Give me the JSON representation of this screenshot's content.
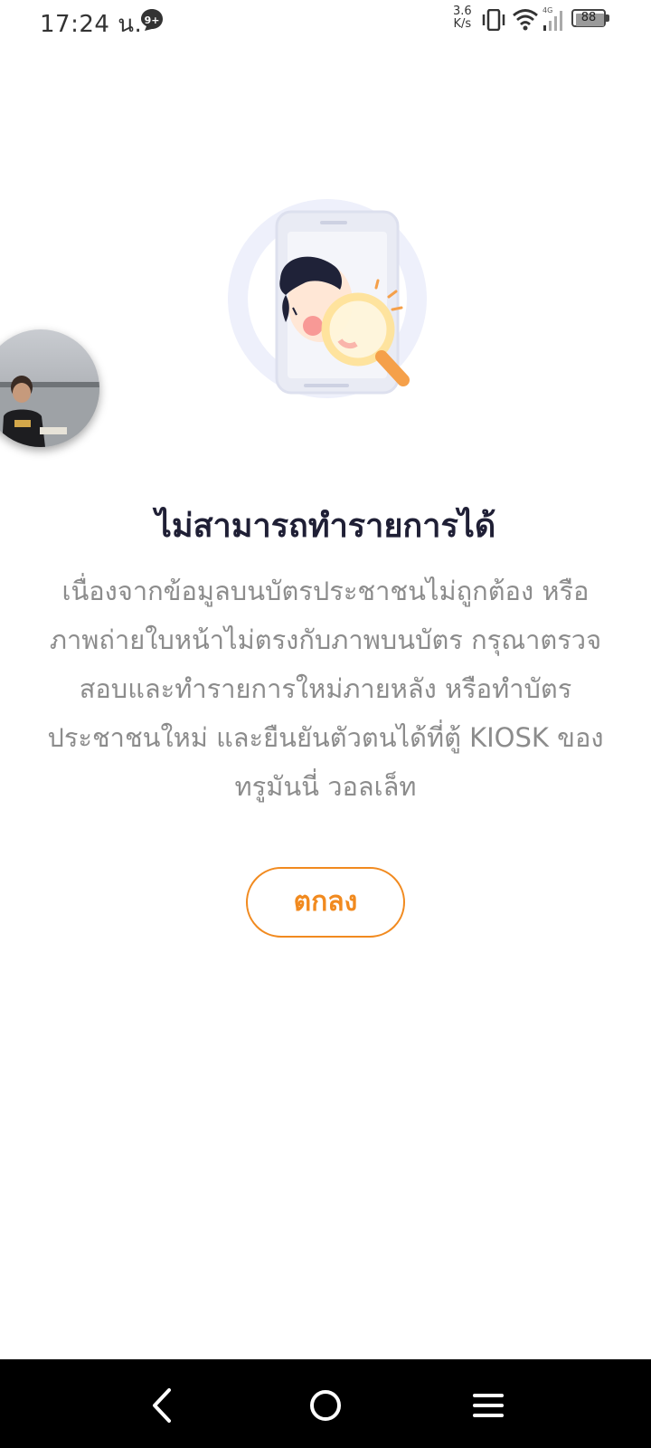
{
  "status_bar": {
    "time": "17:24 น.",
    "notification_badge": "9+",
    "net_speed_value": "3.6",
    "net_speed_unit": "K/s",
    "network_type": "4G",
    "battery_level": "88"
  },
  "dialog": {
    "title": "ไม่สามารถทำรายการได้",
    "message": "เนื่องจากข้อมูลบนบัตรประชาชนไม่ถูกต้อง หรือภาพถ่ายใบหน้าไม่ตรงกับภาพบนบัตร กรุณาตรวจสอบและทำรายการใหม่ภายหลัง หรือทำบัตรประชาชนใหม่ และยืนยันตัวตนได้ที่ตู้ KIOSK ของ ทรูมันนี่ วอลเล็ท",
    "confirm_label": "ตกลง"
  },
  "colors": {
    "accent": "#f18a1f",
    "title": "#1f1f35",
    "body_text": "#8c8c8c",
    "nav_bar": "#000000"
  },
  "icons": {
    "illustration": "face-verification-magnifier-illustration",
    "back": "back-chevron-icon",
    "home": "home-circle-icon",
    "menu": "menu-lines-icon"
  }
}
